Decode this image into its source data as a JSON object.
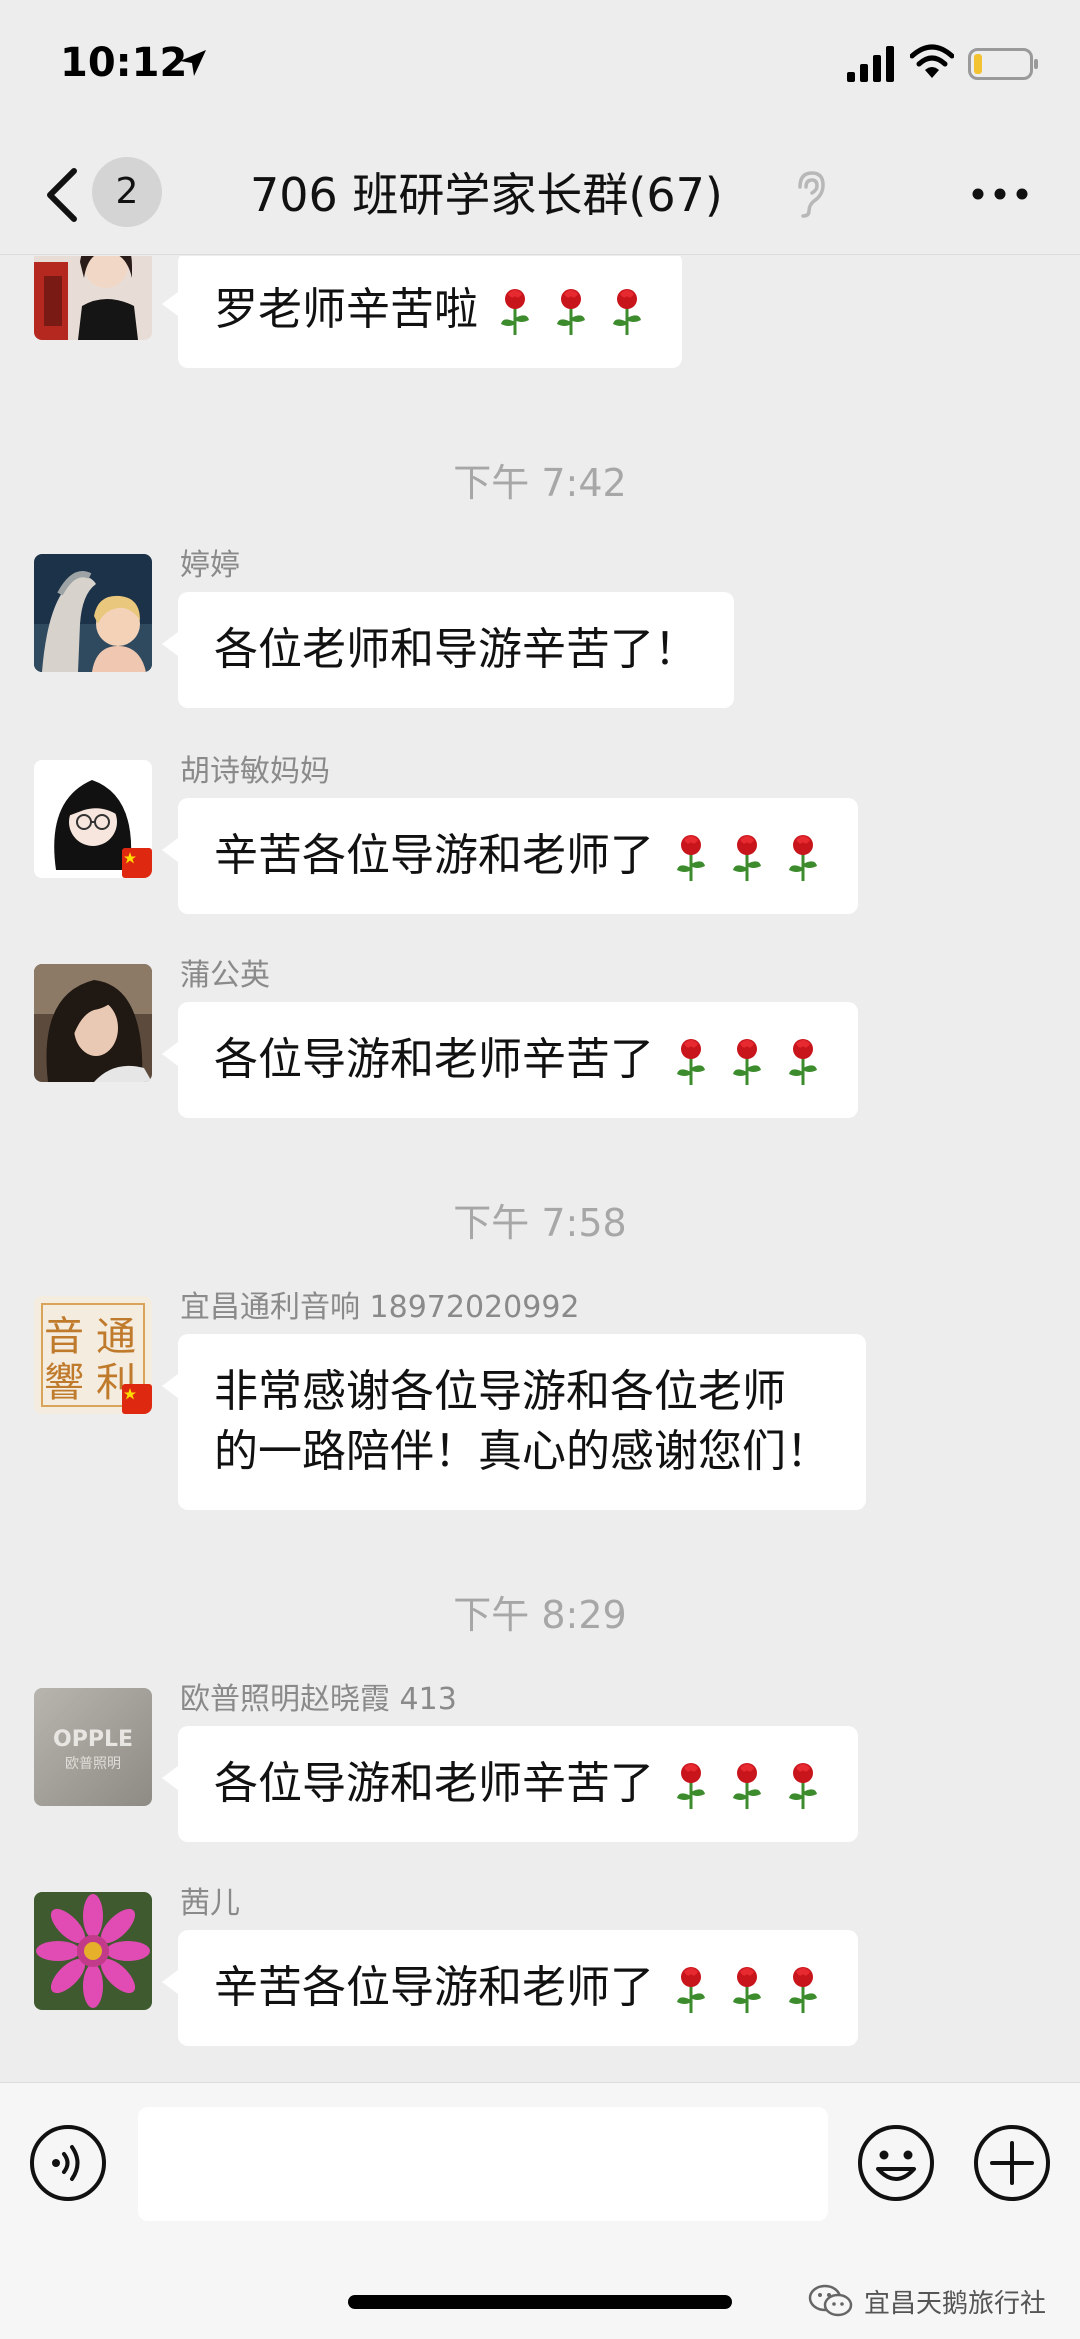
{
  "status_bar": {
    "time": "10:12"
  },
  "nav": {
    "unread_count": "2",
    "title": "706 班研学家长群(67)"
  },
  "chat": {
    "messages": [
      {
        "sender": "",
        "text": "罗老师辛苦啦",
        "roses": 3
      },
      {
        "sender": "婷婷",
        "text": "各位老师和导游辛苦了！",
        "roses": 0
      },
      {
        "sender": "胡诗敏妈妈",
        "text": "辛苦各位导游和老师了",
        "roses": 3
      },
      {
        "sender": "蒲公英",
        "text": "各位导游和老师辛苦了",
        "roses": 3
      },
      {
        "sender": "宜昌通利音响 18972020992",
        "text_line1": "非常感谢各位导游和各位老师",
        "text_line2": "的一路陪伴！真心的感谢您们！",
        "roses": 0
      },
      {
        "sender": "欧普照明赵晓霞 413",
        "text": "各位导游和老师辛苦了",
        "roses": 3
      },
      {
        "sender": "茜儿",
        "text": "辛苦各位导游和老师了",
        "roses": 3
      }
    ],
    "time_dividers": [
      "下午 7:42",
      "下午 7:58",
      "下午 8:29"
    ],
    "avatar_text": {
      "tongli": [
        "音",
        "通",
        "響",
        "利"
      ],
      "opple_top": "OPPLE",
      "opple_bottom": "欧普照明"
    }
  },
  "input_bar": {
    "placeholder": ""
  },
  "watermark": {
    "text": "宜昌天鹅旅行社"
  },
  "icons": {
    "back": "chevron-left-icon",
    "mute": "ear-icon",
    "more": "ellipsis-icon",
    "voice": "voice-icon",
    "emoji": "emoji-icon",
    "plus": "plus-icon",
    "rose": "rose-icon"
  },
  "colors": {
    "background": "#ededed",
    "bubble": "#ffffff",
    "timestamp": "#a7a7a7",
    "sender": "#8a8a8a"
  }
}
